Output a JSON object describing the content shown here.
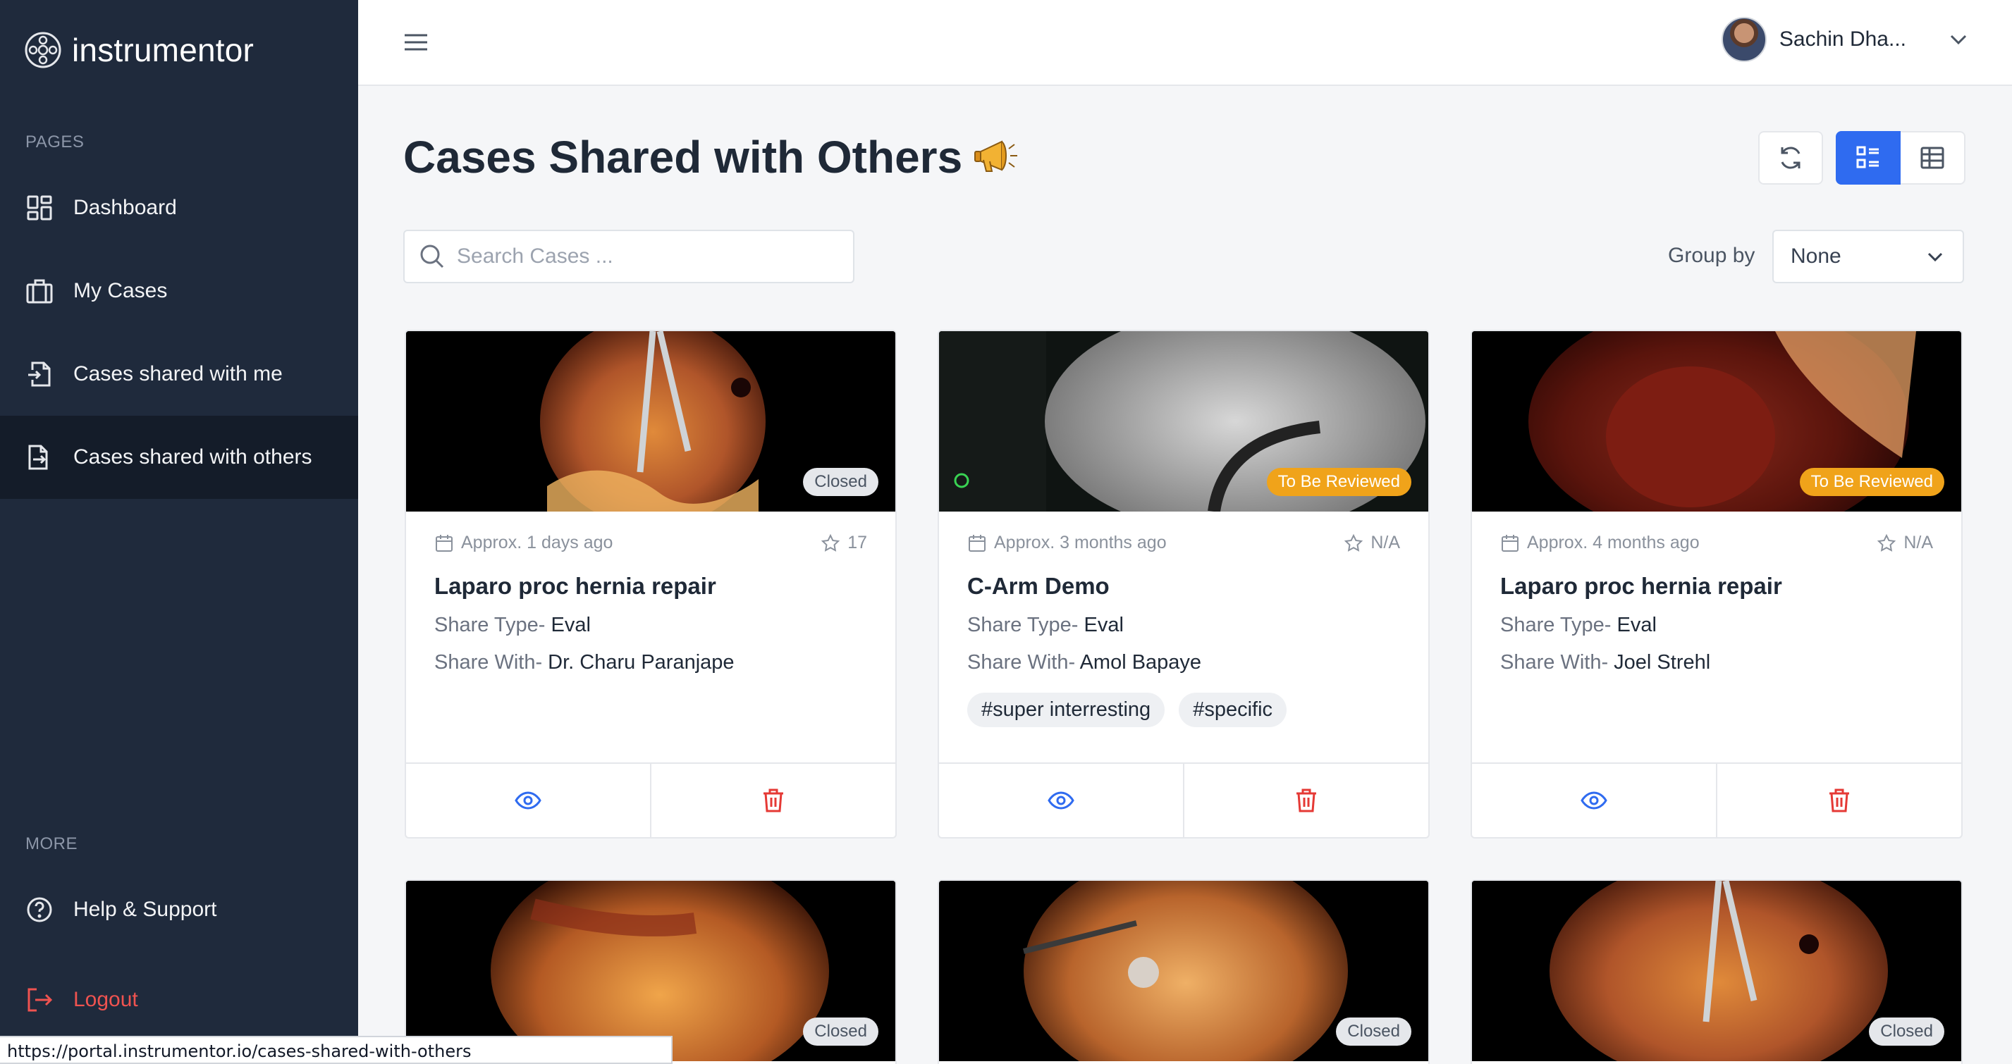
{
  "app": {
    "name": "instrumentor"
  },
  "sidebar": {
    "pages_label": "PAGES",
    "items": [
      {
        "label": "Dashboard",
        "icon": "dashboard-icon"
      },
      {
        "label": "My Cases",
        "icon": "briefcase-icon"
      },
      {
        "label": "Cases shared with me",
        "icon": "file-import-icon"
      },
      {
        "label": "Cases shared with others",
        "icon": "file-export-icon",
        "active": true
      }
    ],
    "more_label": "MORE",
    "help_label": "Help & Support",
    "logout_label": "Logout"
  },
  "header": {
    "user_name": "Sachin Dha..."
  },
  "main": {
    "title": "Cases Shared with Others",
    "search_placeholder": "Search Cases ...",
    "group_by_label": "Group by",
    "group_by_value": "None"
  },
  "cards": [
    {
      "date": "Approx. 1 days ago",
      "rating": "17",
      "title": "Laparo proc hernia repair",
      "share_type_label": "Share Type-",
      "share_type": "Eval",
      "share_with_label": "Share With-",
      "share_with": "Dr. Charu Paranjape",
      "status": "Closed",
      "tags": []
    },
    {
      "date": "Approx. 3 months ago",
      "rating": "N/A",
      "title": "C-Arm Demo",
      "share_type_label": "Share Type-",
      "share_type": "Eval",
      "share_with_label": "Share With-",
      "share_with": "Amol Bapaye",
      "status": "To Be Reviewed",
      "tags": [
        "#super interresting",
        "#specific"
      ]
    },
    {
      "date": "Approx. 4 months ago",
      "rating": "N/A",
      "title": "Laparo proc hernia repair",
      "share_type_label": "Share Type-",
      "share_type": "Eval",
      "share_with_label": "Share With-",
      "share_with": "Joel Strehl",
      "status": "To Be Reviewed",
      "tags": []
    },
    {
      "status": "Closed"
    },
    {
      "status": "Closed"
    },
    {
      "status": "Closed"
    }
  ],
  "colors": {
    "sidebar_bg": "#1f2a3c",
    "accent": "#2f6bf0",
    "danger": "#e53935",
    "review_badge": "#f0a31a"
  },
  "statusbar": {
    "url": "https://portal.instrumentor.io/cases-shared-with-others"
  }
}
